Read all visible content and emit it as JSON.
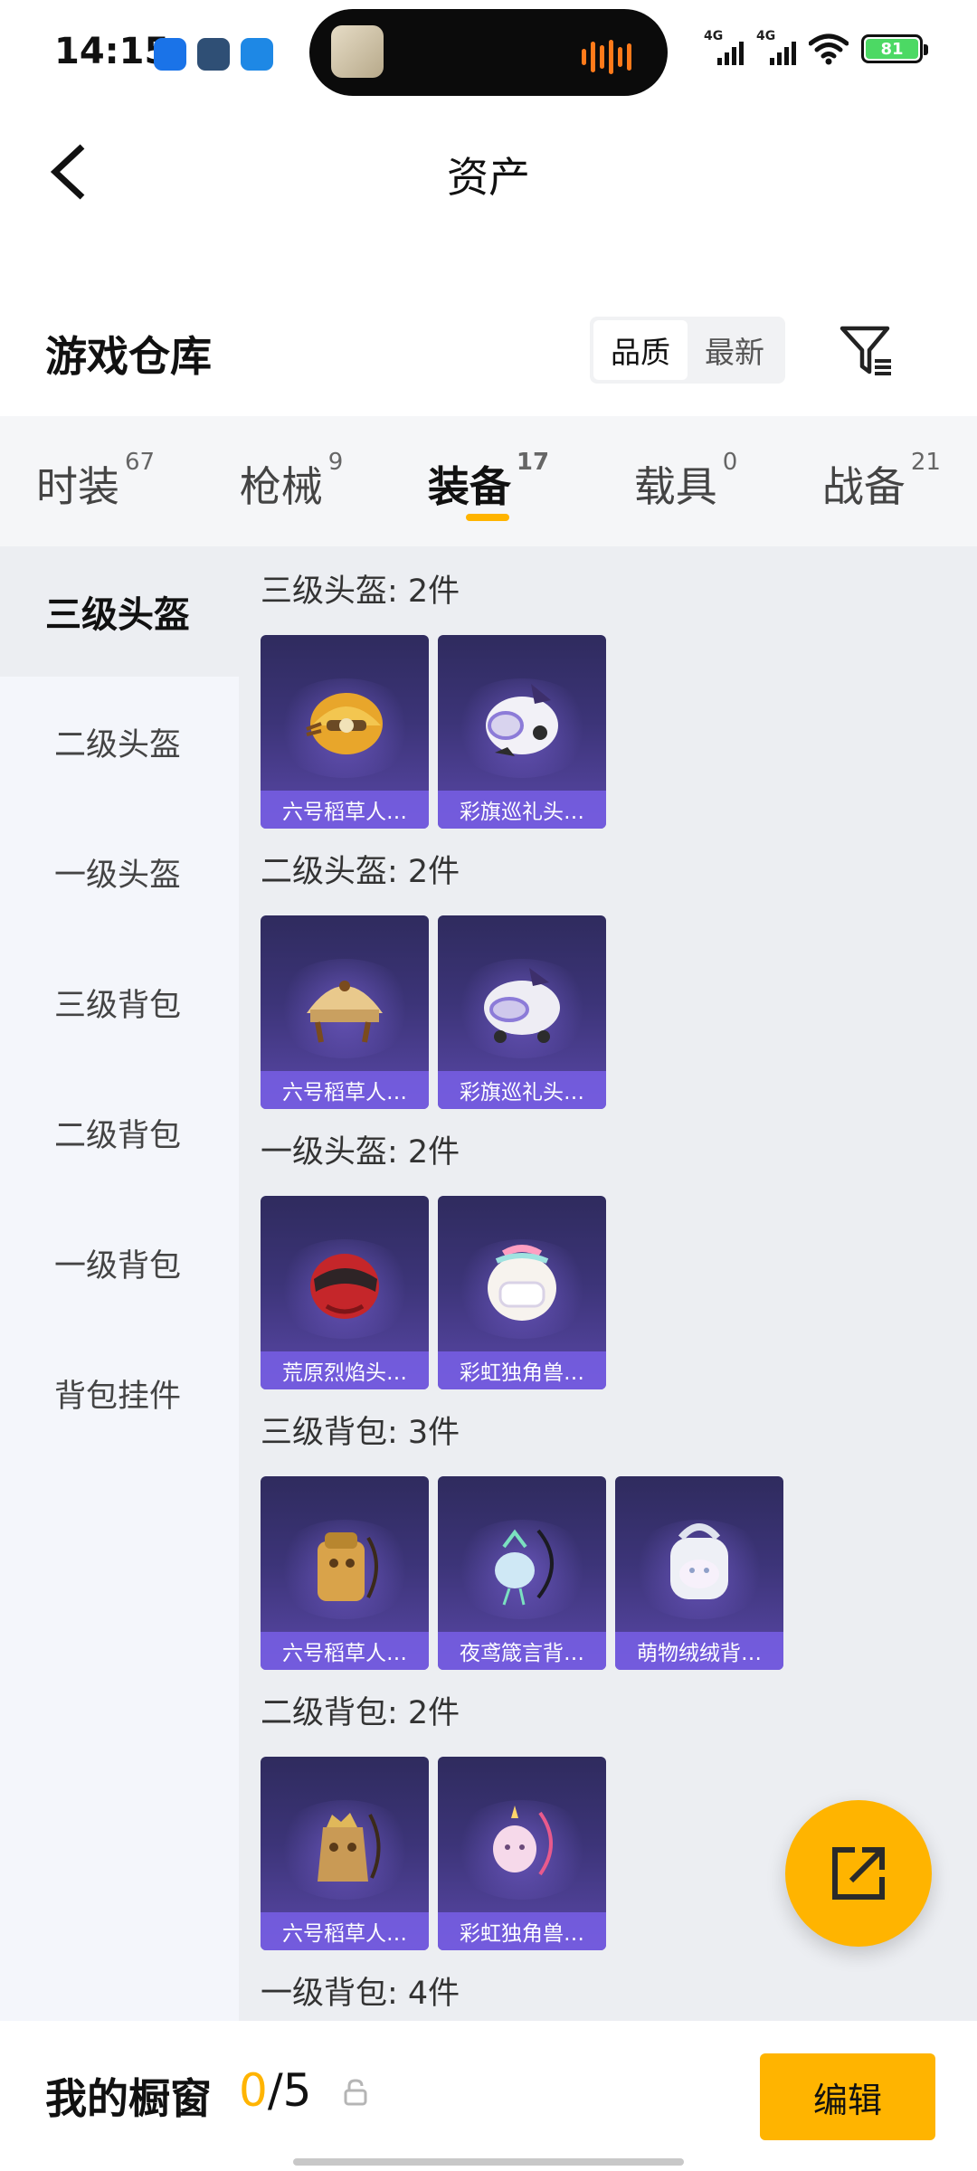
{
  "status_bar": {
    "time": "14:15",
    "signal_1_tag": "4G",
    "signal_2_tag": "4G",
    "battery": "81",
    "colors": {
      "wave": "#ff7a1a",
      "battery": "#4cd964"
    },
    "app_colors": [
      "#1a73e8",
      "#2f4f75",
      "#1e88e5"
    ]
  },
  "header": {
    "title": "资产",
    "back_icon": "chevron-left-icon"
  },
  "warehouse": {
    "title": "游戏仓库",
    "sort_options": [
      "品质",
      "最新"
    ],
    "filter_icon": "filter-icon"
  },
  "tabs": [
    {
      "label": "时装",
      "count": "67"
    },
    {
      "label": "枪械",
      "count": "9"
    },
    {
      "label": "装备",
      "count": "17"
    },
    {
      "label": "载具",
      "count": "0"
    },
    {
      "label": "战备",
      "count": "21"
    }
  ],
  "sidebar": {
    "items": [
      {
        "label": "三级头盔"
      },
      {
        "label": "二级头盔"
      },
      {
        "label": "一级头盔"
      },
      {
        "label": "三级背包"
      },
      {
        "label": "二级背包"
      },
      {
        "label": "一级背包"
      },
      {
        "label": "背包挂件"
      }
    ]
  },
  "sections": [
    {
      "title": "三级头盔: 2件",
      "items": [
        {
          "name": "六号稻草人…"
        },
        {
          "name": "彩旗巡礼头…"
        }
      ]
    },
    {
      "title": "二级头盔: 2件",
      "items": [
        {
          "name": "六号稻草人…"
        },
        {
          "name": "彩旗巡礼头…"
        }
      ]
    },
    {
      "title": "一级头盔: 2件",
      "items": [
        {
          "name": "荒原烈焰头…"
        },
        {
          "name": "彩虹独角兽…"
        }
      ]
    },
    {
      "title": "三级背包: 3件",
      "items": [
        {
          "name": "六号稻草人…"
        },
        {
          "name": "夜鸢箴言背…"
        },
        {
          "name": "萌物绒绒背…"
        }
      ]
    },
    {
      "title": "二级背包: 2件",
      "items": [
        {
          "name": "六号稻草人…"
        },
        {
          "name": "彩虹独角兽…"
        }
      ]
    },
    {
      "title": "一级背包: 4件",
      "items": []
    }
  ],
  "bottom_bar": {
    "label": "我的橱窗",
    "current": "0",
    "separator_total": "/5",
    "edit_label": "编辑"
  },
  "colors": {
    "accent": "#ffb400",
    "card_bg": "#3c3478",
    "card_label": "#785fe6"
  }
}
